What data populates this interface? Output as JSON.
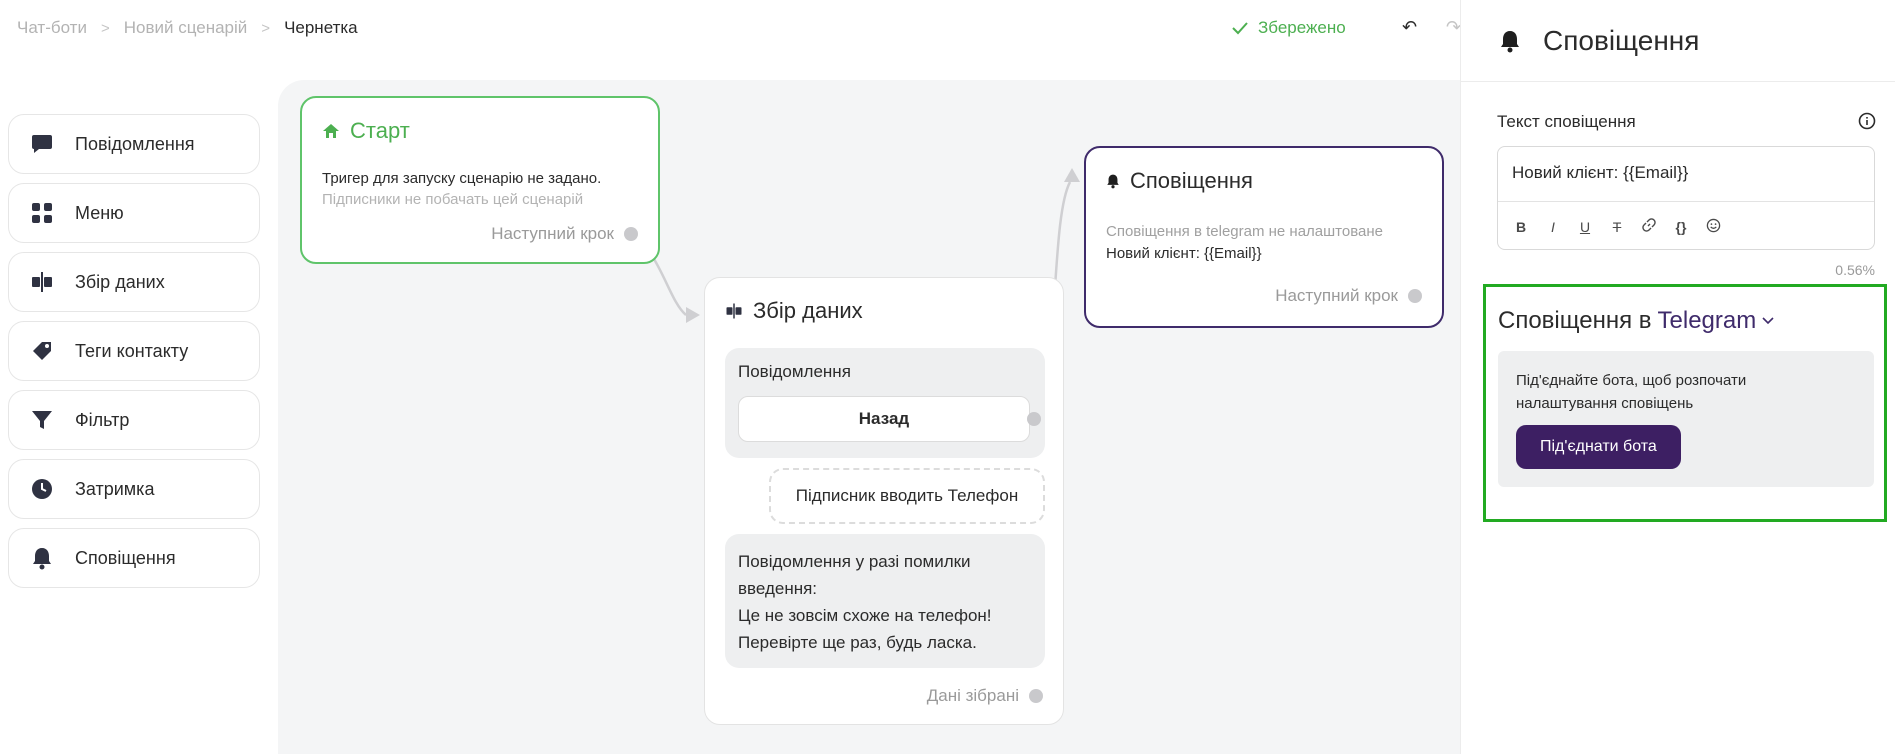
{
  "breadcrumb": {
    "items": [
      "Чат-боти",
      "Новий сценарій"
    ],
    "current": "Чернетка"
  },
  "status": {
    "saved_label": "Збережено",
    "color": "#4caf50"
  },
  "palette": {
    "items": [
      {
        "label": "Повідомлення",
        "icon": "chat-bubble-icon"
      },
      {
        "label": "Меню",
        "icon": "grid-icon"
      },
      {
        "label": "Збір даних",
        "icon": "data-collect-icon"
      },
      {
        "label": "Теги контакту",
        "icon": "tag-icon"
      },
      {
        "label": "Фільтр",
        "icon": "filter-icon"
      },
      {
        "label": "Затримка",
        "icon": "clock-icon"
      },
      {
        "label": "Сповіщення",
        "icon": "bell-icon"
      }
    ]
  },
  "nodes": {
    "start": {
      "title": "Старт",
      "text": "Тригер для запуску сценарію не задано.",
      "subtext": "Підписники не побачать цей сценарій",
      "next_label": "Наступний крок"
    },
    "collect": {
      "title": "Збір даних",
      "message_label": "Повідомлення",
      "back_button": "Назад",
      "input_label": "Підписник вводить Телефон",
      "error_lines": [
        "Повідомлення у разі помилки",
        "введення:",
        "Це не зовсім схоже на телефон!",
        "Перевірте ще раз, будь ласка."
      ],
      "done_label": "Дані зібрані"
    },
    "notify": {
      "title": "Сповіщення",
      "warning": "Сповіщення в telegram не налаштоване",
      "text": "Новий клієнт: {{Email}}",
      "next_label": "Наступний крок"
    }
  },
  "panel": {
    "title": "Сповіщення",
    "field_label": "Текст сповіщення",
    "editor_value": "Новий клієнт: {{Email}}",
    "toolbar": [
      "B",
      "I",
      "U",
      "T",
      "link",
      "{}",
      "emoji"
    ],
    "usage_percent": "0.56%",
    "telegram": {
      "title_prefix": "Сповіщення в",
      "title_accent": "Telegram",
      "description": "Під'єднайте бота, щоб розпочати налаштування сповіщень",
      "button_label": "Під'єднати бота",
      "accent_color": "#3d1f63"
    }
  }
}
